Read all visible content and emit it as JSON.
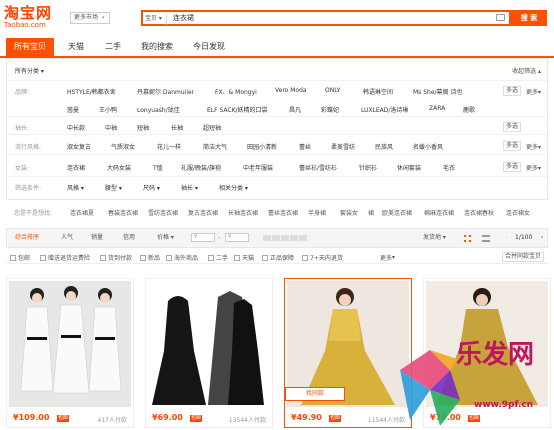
{
  "header": {
    "logo_cn": "淘宝网",
    "logo_en": "Taobao.com",
    "market_select": "更多市场",
    "search_type": "宝贝",
    "search_value": "连衣裙",
    "search_button": "搜 索"
  },
  "tabs": [
    "所有宝贝",
    "天猫",
    "二手",
    "我的搜索",
    "今日发现"
  ],
  "filters": {
    "all_categories": "所有分类",
    "collapse": "收起筛选",
    "brand": {
      "label": "品牌:",
      "items": [
        "HSTYLE/韩都衣舍",
        "丹慕妮尔 Danmuiier",
        "FX、& Mongyi",
        "Vero Moda",
        "ONLY",
        "韩语琳空间",
        "Ms She/幕阁 诗也",
        "茵曼",
        "王小鸭",
        "Lonyuash/珑佳",
        "ELF SACK/妖精的口袋",
        "昌凡",
        "彩蝶妃",
        "LUXLEAD/洛诗琳",
        "ZARA",
        "鹿歌"
      ],
      "multi": "多选",
      "more": "更多"
    },
    "sleeve": {
      "label": "袖长:",
      "items": [
        "中长款",
        "中袖",
        "短袖",
        "长袖",
        "超短袖"
      ],
      "multi": "多选"
    },
    "style": {
      "label": "流行风格:",
      "items": [
        "淑女复古",
        "气质淑女",
        "花儿一样",
        "简洁大气",
        "田园小清新",
        "蕾丝",
        "柔美雪纺",
        "民族风",
        "名媛小香风"
      ],
      "multi": "多选",
      "more": "更多"
    },
    "women": {
      "label": "女装:",
      "items": [
        "连衣裙",
        "大码女装",
        "T恤",
        "礼服/晚装/旗袍",
        "中老年服装",
        "蕾丝衫/雪纺衫",
        "针织衫",
        "休闲套装",
        "毛衣"
      ],
      "multi": "多选",
      "more": "更多"
    },
    "conditions": {
      "label": "筛选条件:",
      "items": [
        "风格",
        "腰型",
        "尺码",
        "袖长",
        "相关分类"
      ]
    }
  },
  "related": {
    "label": "您是不是想找:",
    "items": [
      "连衣裙夏",
      "春装连衣裙",
      "雪纺连衣裙",
      "复古连衣裙",
      "长袖连衣裙",
      "蕾丝连衣裙",
      "半身裙",
      "套装女",
      "裙",
      "欧美连衣裙",
      "棉麻连衣裙",
      "连衣裙春秋",
      "连衣裙女"
    ]
  },
  "sort": {
    "items": [
      "综合排序",
      "人气",
      "销量",
      "信用",
      "价格"
    ],
    "price_from": "¥",
    "price_to": "¥",
    "ship_from": "发货地",
    "page": "1/100"
  },
  "options": {
    "items": [
      "包邮",
      "赠送退货运费险",
      "货到付款",
      "新品",
      "海外商品",
      "二手",
      "天猫",
      "正品保障",
      "7+天内退货"
    ],
    "more": "更多",
    "merge": "合并同款宝贝"
  },
  "products": [
    {
      "price": "¥109.00",
      "sold": "417人付款",
      "colors": [
        "#f2f2f2",
        "#e8e8e8"
      ]
    },
    {
      "price": "¥69.00",
      "sold": "13544人付款",
      "colors": [
        "#222",
        "#111"
      ]
    },
    {
      "price": "¥49.90",
      "sold": "11544人付款",
      "tag": "找同款",
      "colors": [
        "#c8a83a",
        "#e6c94a"
      ]
    },
    {
      "price": "¥79.00",
      "sold": "",
      "colors": [
        "#b08f2e",
        "#d3b750"
      ]
    }
  ],
  "watermark": {
    "cn": "乐发网",
    "url": "www.9pf.cn"
  },
  "accent_color": "#ff5000"
}
